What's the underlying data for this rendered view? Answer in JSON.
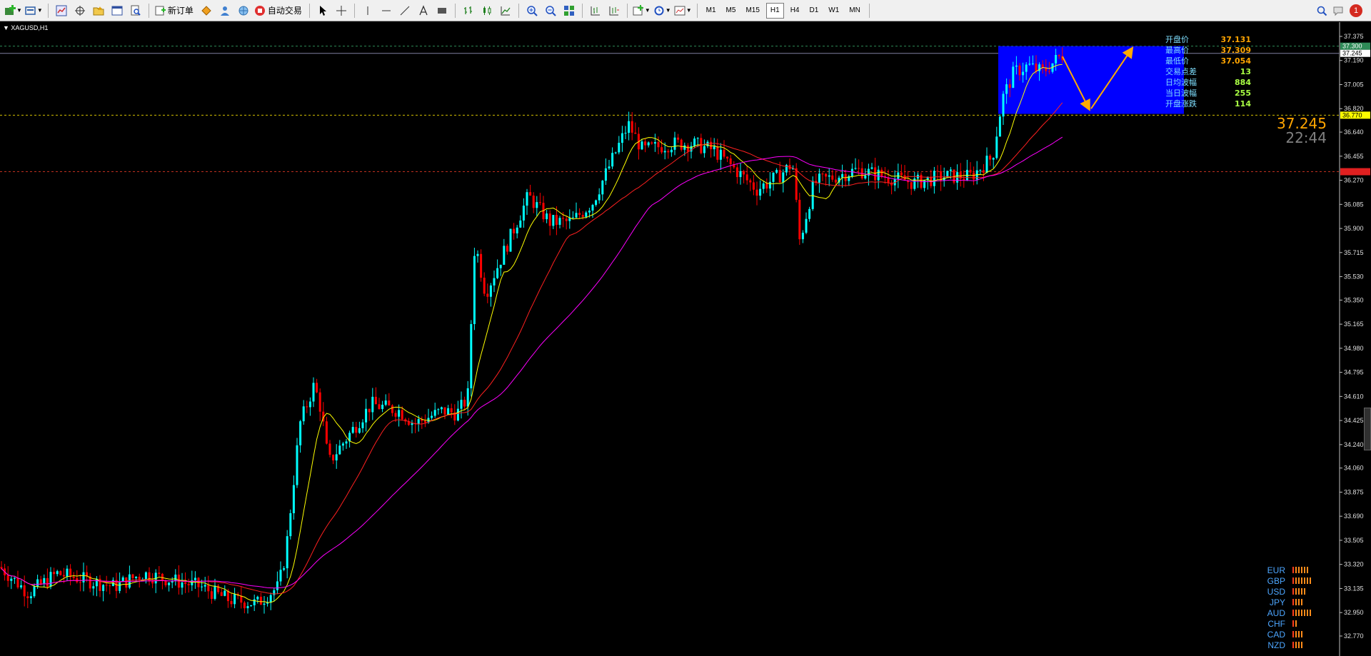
{
  "toolbar": {
    "new_order_label": "新订单",
    "auto_trading_label": "自动交易",
    "timeframes": [
      "M1",
      "M5",
      "M15",
      "H1",
      "H4",
      "D1",
      "W1",
      "MN"
    ],
    "active_timeframe": "H1",
    "notification_count": "1"
  },
  "chart": {
    "symbol": "XAGUSD,H1",
    "price_scale": [
      "37.375",
      "37.190",
      "37.005",
      "36.820",
      "36.640",
      "36.455",
      "36.270",
      "36.085",
      "35.900",
      "35.715",
      "35.530",
      "35.350",
      "35.165",
      "34.980",
      "34.795",
      "34.610",
      "34.425",
      "34.240",
      "34.060",
      "33.875",
      "33.690",
      "33.505",
      "33.320",
      "33.135",
      "32.950",
      "32.770"
    ],
    "price_tags": {
      "ask": "37.300",
      "bid": "37.245",
      "yellow_level": "36.770",
      "red_level": "36.336"
    },
    "colors": {
      "bull": "#00ffff",
      "bear": "#ff0000",
      "ma_fast": "#ffff00",
      "ma_mid": "#ff2020",
      "ma_slow": "#ff00ff",
      "box": "#0000ff",
      "arrow": "#ffaa00"
    }
  },
  "info": {
    "rows": [
      {
        "label": "开盘价",
        "value": "37.131",
        "color": "orange"
      },
      {
        "label": "最高价",
        "value": "37.309",
        "color": "orange"
      },
      {
        "label": "最低价",
        "value": "37.054",
        "color": "orange"
      },
      {
        "label": "交易点差",
        "value": "13",
        "color": "green"
      },
      {
        "label": "日均波幅",
        "value": "884",
        "color": "green"
      },
      {
        "label": "当日波幅",
        "value": "255",
        "color": "green"
      },
      {
        "label": "开盘涨跌",
        "value": "114",
        "color": "green"
      }
    ],
    "big_price": "37.245",
    "big_time": "22:44"
  },
  "currency_strength": [
    {
      "name": "EUR",
      "bars": 6
    },
    {
      "name": "GBP",
      "bars": 7
    },
    {
      "name": "USD",
      "bars": 5
    },
    {
      "name": "JPY",
      "bars": 4
    },
    {
      "name": "AUD",
      "bars": 7
    },
    {
      "name": "CHF",
      "bars": 2
    },
    {
      "name": "CAD",
      "bars": 4
    },
    {
      "name": "NZD",
      "bars": 4
    }
  ]
}
